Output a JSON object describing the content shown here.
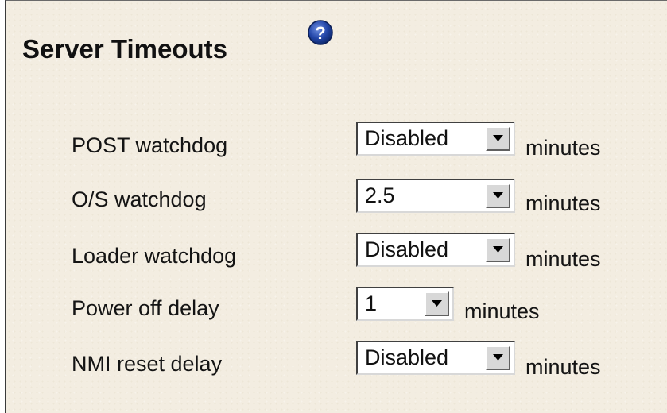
{
  "title": "Server Timeouts",
  "help_icon": "question-mark-help-icon",
  "rows": [
    {
      "label": "POST watchdog",
      "value": "Disabled",
      "unit": "minutes"
    },
    {
      "label": "O/S watchdog",
      "value": "2.5",
      "unit": "minutes"
    },
    {
      "label": "Loader watchdog",
      "value": "Disabled",
      "unit": "minutes"
    },
    {
      "label": "Power off delay",
      "value": "1",
      "unit": "minutes"
    },
    {
      "label": "NMI reset delay",
      "value": "Disabled",
      "unit": "minutes"
    }
  ],
  "colors": {
    "panel_background": "#f3ede1",
    "help_icon": "#1f3f9a",
    "dropdown_button": "#d8d8d8"
  }
}
